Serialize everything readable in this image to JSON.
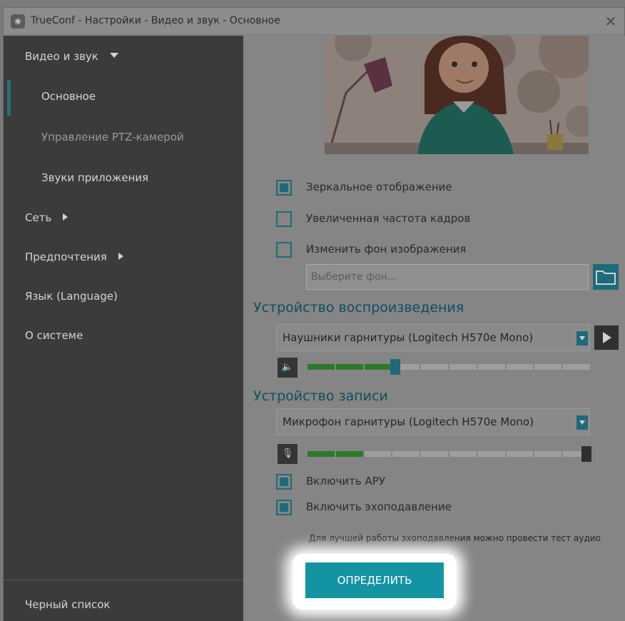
{
  "window": {
    "title": "TrueConf - Настройки - Видео и звук - Основное",
    "close_label": "✕"
  },
  "sidebar": {
    "video_sound": "Видео и звук",
    "basic": "Основное",
    "ptz": "Управление PTZ-камерой",
    "app_sounds": "Звуки приложения",
    "network": "Сеть",
    "preferences": "Предпочтения",
    "language": "Язык (Language)",
    "about": "О системе",
    "blacklist": "Черный список"
  },
  "video": {
    "mirror": {
      "label": "Зеркальное отображение",
      "checked": true
    },
    "high_fps": {
      "label": "Увеличенная частота кадров",
      "checked": false
    },
    "change_bg": {
      "label": "Изменить фон изображения",
      "checked": false
    },
    "bg_placeholder": "Выберите фон..."
  },
  "playback": {
    "title": "Устройство воспроизведения",
    "device": "Наушники гарнитуры (Logitech H570e Mono)",
    "volume_fraction": 0.31
  },
  "recording": {
    "title": "Устройство записи",
    "device": "Микрофон гарнитуры (Logitech H570e Mono)",
    "level_fraction": 0.18,
    "agc": {
      "label": "Включить АРУ",
      "checked": true
    },
    "echo": {
      "label": "Включить эхоподавление",
      "checked": true
    }
  },
  "hint": "Для лучшей работы эхоподавления можно провести тест аудио",
  "detect_button": "ОПРЕДЕЛИТЬ",
  "colors": {
    "accent": "#1493a3",
    "level_on": "#2c7a2a",
    "section_title": "#0f4e62"
  }
}
